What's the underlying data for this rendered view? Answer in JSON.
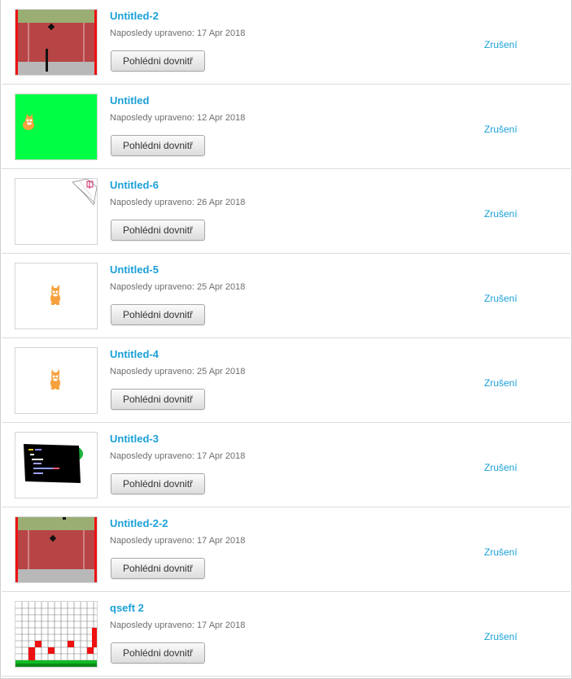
{
  "projects": [
    {
      "title": "Untitled-2",
      "modified": "Naposledy upraveno: 17 Apr 2018",
      "view_label": "Pohlédni dovnitř",
      "cancel_label": "Zrušení",
      "thumb": "red-platform-game"
    },
    {
      "title": "Untitled",
      "modified": "Naposledy upraveno: 12 Apr 2018",
      "view_label": "Pohlédni dovnitř",
      "cancel_label": "Zrušení",
      "thumb": "green-stage-cat"
    },
    {
      "title": "Untitled-6",
      "modified": "Naposledy upraveno: 26 Apr 2018",
      "view_label": "Pohlédni dovnitř",
      "cancel_label": "Zrušení",
      "thumb": "white-stage-sketch"
    },
    {
      "title": "Untitled-5",
      "modified": "Naposledy upraveno: 25 Apr 2018",
      "view_label": "Pohlédni dovnitř",
      "cancel_label": "Zrušení",
      "thumb": "white-stage-cat"
    },
    {
      "title": "Untitled-4",
      "modified": "Naposledy upraveno: 25 Apr 2018",
      "view_label": "Pohlédni dovnitř",
      "cancel_label": "Zrušení",
      "thumb": "white-stage-cat"
    },
    {
      "title": "Untitled-3",
      "modified": "Naposledy upraveno: 17 Apr 2018",
      "view_label": "Pohlédni dovnitř",
      "cancel_label": "Zrušení",
      "thumb": "black-code-panel"
    },
    {
      "title": "Untitled-2-2",
      "modified": "Naposledy upraveno: 17 Apr 2018",
      "view_label": "Pohlédni dovnitř",
      "cancel_label": "Zrušení",
      "thumb": "red-platform-game"
    },
    {
      "title": "qseft 2",
      "modified": "Naposledy upraveno: 17 Apr 2018",
      "view_label": "Pohlédni dovnitř",
      "cancel_label": "Zrušení",
      "thumb": "grid-level"
    }
  ],
  "colors": {
    "link": "#1aa0d8",
    "meta_text": "#6e6e6e",
    "divider": "#dcdcdc"
  }
}
